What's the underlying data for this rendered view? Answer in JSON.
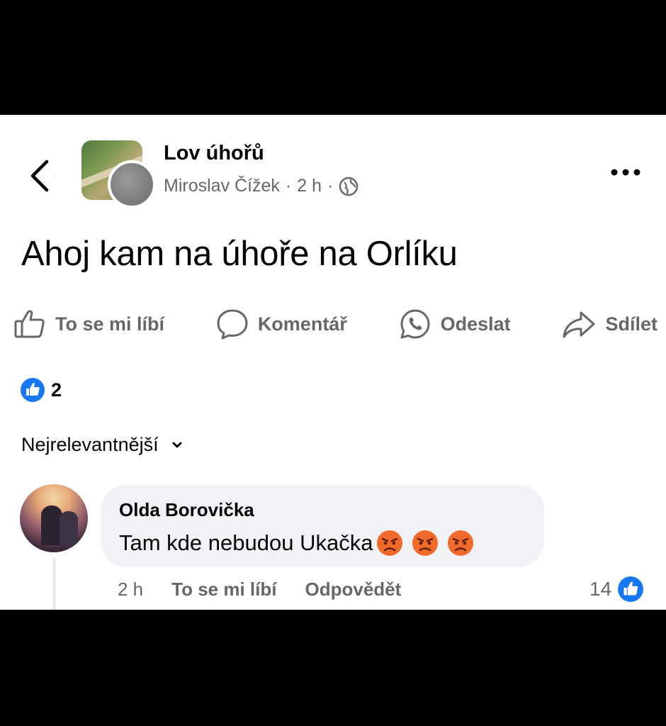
{
  "post": {
    "group_name": "Lov úhořů",
    "author": "Miroslav Čížek",
    "time": "2 h",
    "separator": "·",
    "text": "Ahoj kam na úhoře na Orlíku"
  },
  "actions": {
    "like": "To se mi líbí",
    "comment": "Komentář",
    "send": "Odeslat",
    "share": "Sdílet"
  },
  "reactions": {
    "count": "2"
  },
  "sort": {
    "label": "Nejrelevantnější"
  },
  "comment": {
    "author": "Olda Borovička",
    "text": "Tam kde nebudou Ukačka",
    "time": "2 h",
    "like_label": "To se mi líbí",
    "reply_label": "Odpovědět",
    "reaction_count": "14"
  },
  "colors": {
    "accent": "#1877f2",
    "secondary_text": "#65676b",
    "bubble": "#f0f2f5",
    "angry_emoji": "#f26a2a"
  }
}
